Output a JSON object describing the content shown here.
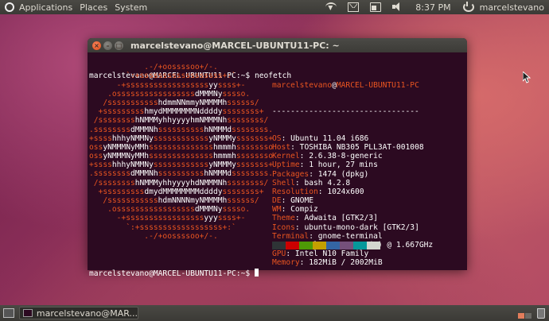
{
  "top_panel": {
    "menus": [
      "Applications",
      "Places",
      "System"
    ],
    "clock": "8:37 PM",
    "user": "marcelstevano"
  },
  "window": {
    "title": "marcelstevano@MARCEL-UBUNTU11-PC: ~"
  },
  "terminal": {
    "prompt": "marcelstevano@MARCEL-UBUNTU11-PC:~$ ",
    "command": "neofetch",
    "logo": [
      "            .-/+oossssoo+/-.",
      "        `:+ssssssssssssssssss+:`",
      "      -+ssssssssssssssssssyyssss+-",
      "    .osssssssssssssssssdMMMNysssso.",
      "   /ssssssssssshdmmNNmmyNMMMMhssssss/",
      "  +ssssssssshmydMMMMMMMNddddyssssssss+",
      " /sssssssshNMMMyhhyyyyhmNMMMNhssssssss/",
      ".ssssssssdMMMNhsssssssssshNMMMdssssssss.",
      "+sssshhhyNMMNyssssssssssssyNMMMysssssss+",
      "ossyNMMMNyMMhsssssssssssssshmmmhssssssso",
      "ossyNMMMNyMMhsssssssssssssshmmmhssssssso",
      "+sssshhhyNMMNyssssssssssssyNMMMysssssss+",
      ".ssssssssdMMMNhsssssssssshNMMMdssssssss.",
      " /sssssssshNMMMyhhyyyyhdNMMMNhssssssss/",
      "  +sssssssssdmydMMMMMMMMddddyssssssss+",
      "   /ssssssssssshdmNNNNmyNMMMMhssssss/",
      "    .osssssssssssssssssdMMMNysssso.",
      "      -+sssssssssssssssssyyyssss+-",
      "        `:+ssssssssssssssssss+:`",
      "            .-/+oossssoo+/-."
    ],
    "info_user": "marcelstevano",
    "info_at": "@",
    "info_host": "MARCEL-UBUNTU11-PC",
    "separator": "--------------------------------",
    "fields": [
      {
        "key": "OS",
        "value": "Ubuntu 11.04 i686"
      },
      {
        "key": "Host",
        "value": "TOSHIBA NB305 PLL3AT-001008"
      },
      {
        "key": "Kernel",
        "value": "2.6.38-8-generic"
      },
      {
        "key": "Uptime",
        "value": "1 hour, 27 mins"
      },
      {
        "key": "Packages",
        "value": "1474 (dpkg)"
      },
      {
        "key": "Shell",
        "value": "bash 4.2.8"
      },
      {
        "key": "Resolution",
        "value": "1024x600"
      },
      {
        "key": "DE",
        "value": "GNOME"
      },
      {
        "key": "WM",
        "value": "Compiz"
      },
      {
        "key": "Theme",
        "value": "Adwaita [GTK2/3]"
      },
      {
        "key": "Icons",
        "value": "ubuntu-mono-dark [GTK2/3]"
      },
      {
        "key": "Terminal",
        "value": "gnome-terminal"
      },
      {
        "key": "CPU",
        "value": "Intel Atom N450 (2) @ 1.667GHz"
      },
      {
        "key": "GPU",
        "value": "Intel N10 Family"
      },
      {
        "key": "Memory",
        "value": "182MiB / 2002MiB"
      }
    ],
    "palette": [
      "#2e3436",
      "#cc0000",
      "#4e9a06",
      "#c4a000",
      "#3465a4",
      "#75507b",
      "#06989a",
      "#d3d7cf"
    ],
    "accent_color": "#e95420"
  },
  "bottom_panel": {
    "task_label": "marcelstevano@MAR..."
  }
}
